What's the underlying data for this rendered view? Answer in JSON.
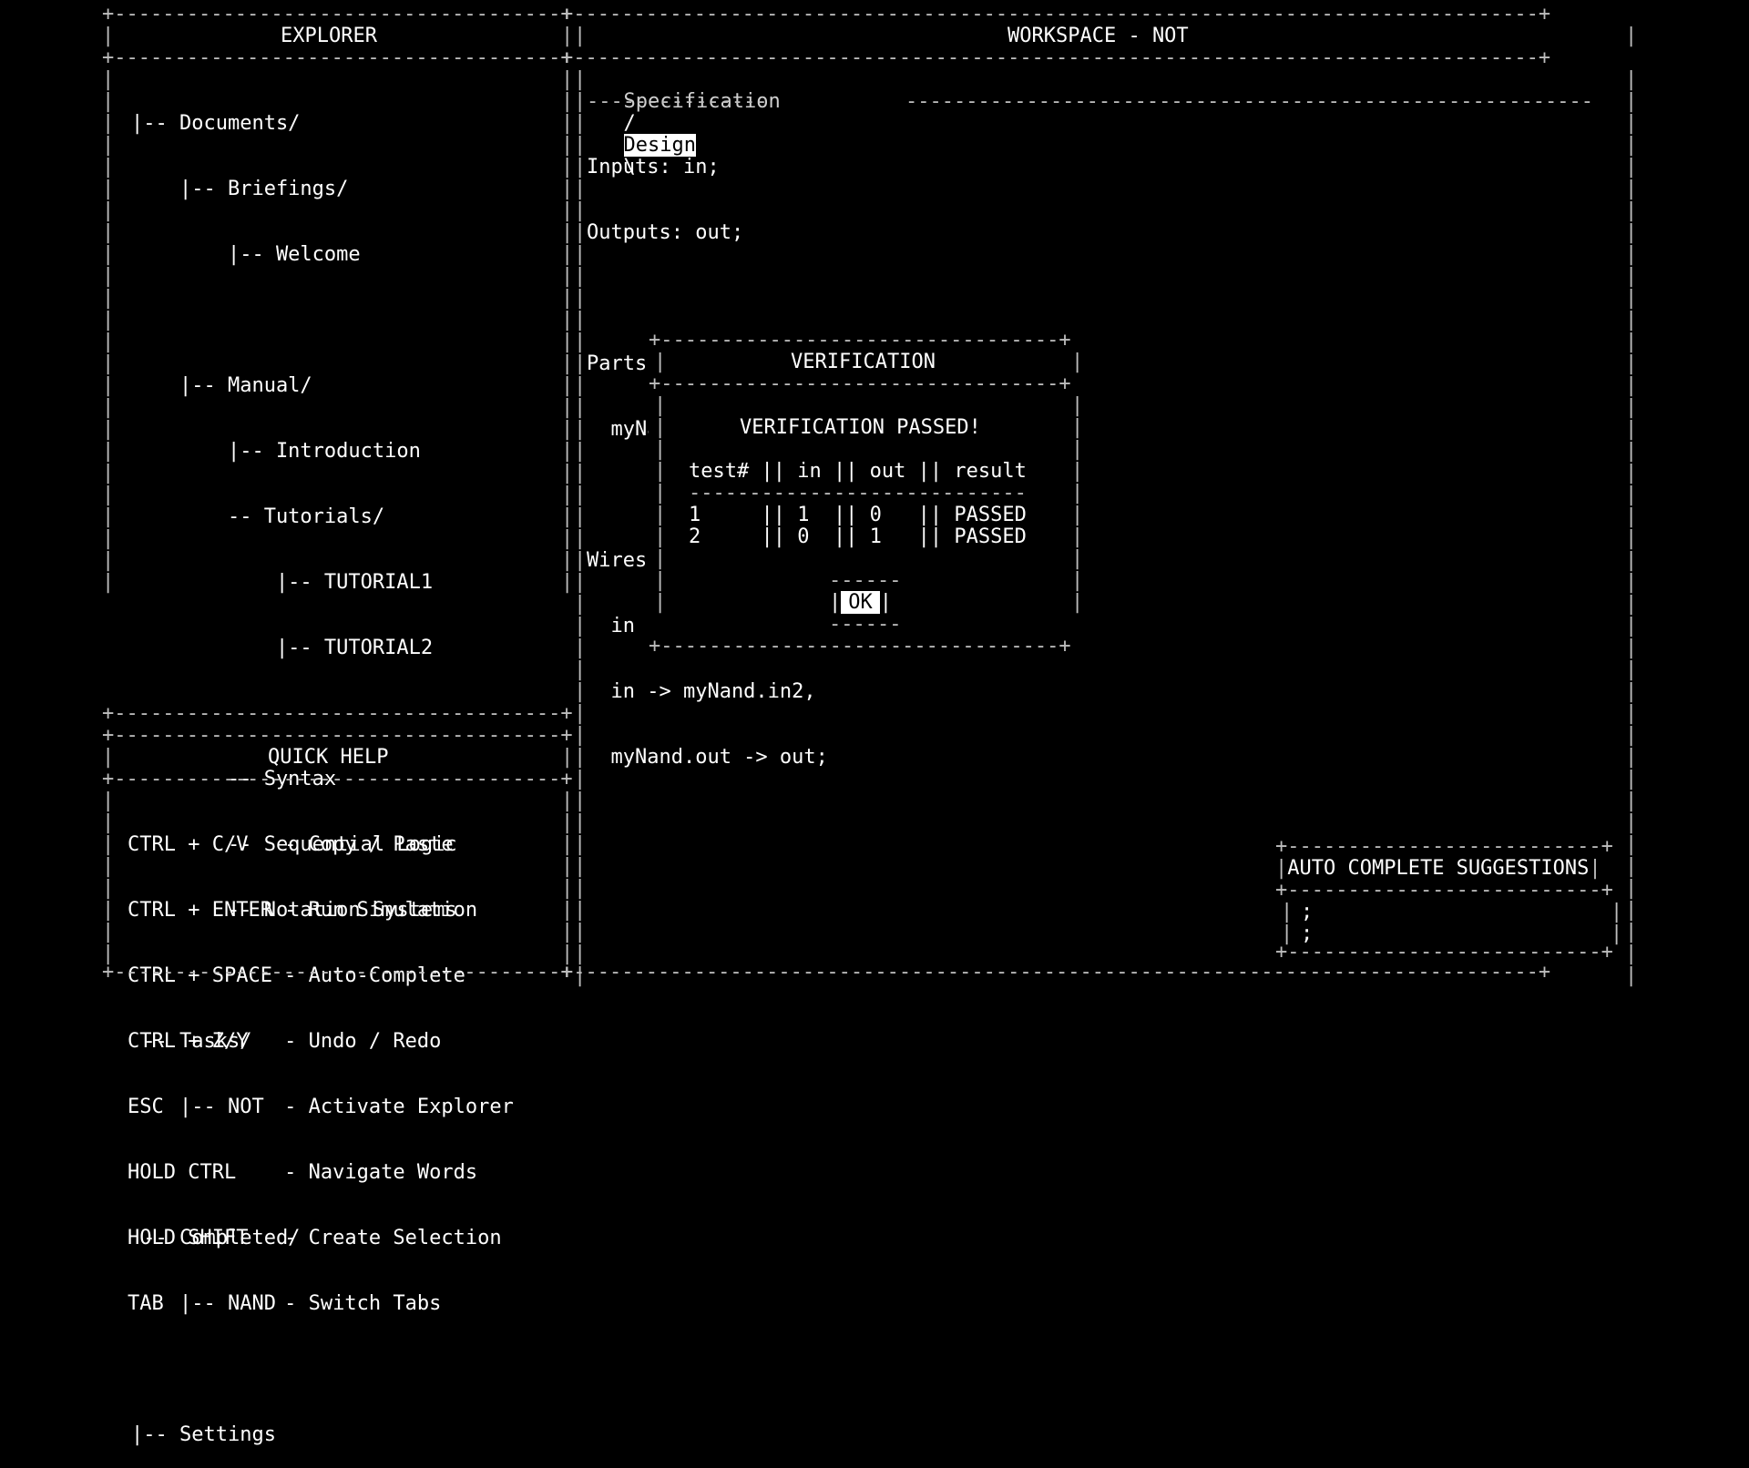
{
  "explorer": {
    "title": "EXPLORER",
    "tree": [
      "|-- Documents/",
      "    |-- Briefings/",
      "        |-- Welcome",
      "",
      "    |-- Manual/",
      "        |-- Introduction",
      "        -- Tutorials/",
      "            |-- TUTORIAL1",
      "            |-- TUTORIAL2",
      "",
      "        -- Syntax",
      "        -- Sequential Logic",
      "        -- Notation Systems",
      "",
      " -- Tasks/",
      "    |-- NOT",
      "",
      " -- Completed/",
      "    |-- NAND",
      "",
      "|-- Settings"
    ]
  },
  "quick_help": {
    "title": "QUICK HELP",
    "shortcuts": [
      "CTRL + C/V   - Copy / Paste",
      "CTRL + ENTER - Run Simulation",
      "CTRL + SPACE - Auto-Complete",
      "CTRL + Z/Y   - Undo / Redo",
      "ESC          - Activate Explorer",
      "HOLD CTRL    - Navigate Words",
      "HOLD SHIFT   - Create Selection",
      "TAB          - Switch Tabs"
    ]
  },
  "workspace": {
    "title": "WORKSPACE - NOT",
    "tabs": {
      "spec": "Specification",
      "sep": "/",
      "design": "Design",
      "end": "\\"
    },
    "code": [
      "Inputs: in;",
      "Outputs: out;",
      "",
      "Parts:",
      "  myNand NAND;",
      "",
      "Wires:",
      "  in -> myNand.in1,",
      "  in -> myNand.in2,",
      "  myNand.out -> out;"
    ]
  },
  "verification": {
    "title": "VERIFICATION",
    "message": "VERIFICATION PASSED!",
    "header": "test# || in || out || result",
    "rule": "----------------------------",
    "rows": [
      "1     || 1  || 0   || PASSED",
      "2     || 0  || 1   || PASSED"
    ],
    "ok_label": "OK"
  },
  "autocomplete": {
    "title": "AUTO COMPLETE SUGGESTIONS",
    "items": [
      ";",
      ";"
    ]
  }
}
